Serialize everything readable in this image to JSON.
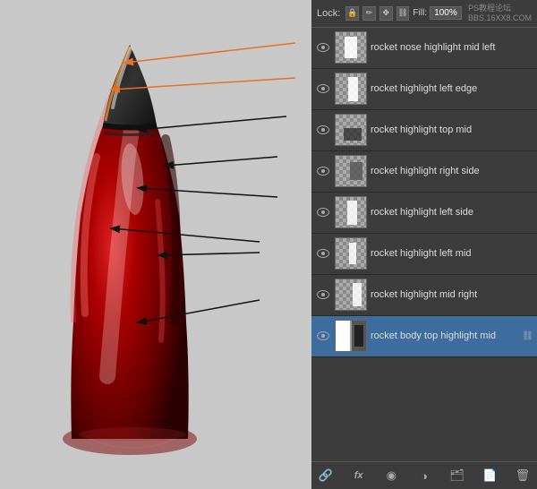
{
  "toolbar": {
    "lock_label": "Lock:",
    "fill_label": "Fill:",
    "fill_value": "100%",
    "watermark": "PS教程论坛\nBBS.16XX8.COM"
  },
  "layers": [
    {
      "id": 1,
      "name": "rocket nose highlight mid left",
      "visible": true,
      "selected": false,
      "thumb_type": "checker_white"
    },
    {
      "id": 2,
      "name": "rocket highlight left edge",
      "visible": true,
      "selected": false,
      "thumb_type": "checker_white"
    },
    {
      "id": 3,
      "name": "rocket highlight top mid",
      "visible": true,
      "selected": false,
      "thumb_type": "checker_dark"
    },
    {
      "id": 4,
      "name": "rocket highlight right side",
      "visible": true,
      "selected": false,
      "thumb_type": "checker_dark"
    },
    {
      "id": 5,
      "name": "rocket highlight left side",
      "visible": true,
      "selected": false,
      "thumb_type": "checker_white"
    },
    {
      "id": 6,
      "name": "rocket highlight left mid",
      "visible": true,
      "selected": false,
      "thumb_type": "checker_white"
    },
    {
      "id": 7,
      "name": "rocket highlight mid right",
      "visible": true,
      "selected": false,
      "thumb_type": "checker_white"
    },
    {
      "id": 8,
      "name": "rocket body top highlight mid",
      "visible": true,
      "selected": true,
      "thumb_type": "white_mask"
    }
  ],
  "bottom_toolbar": {
    "link_icon": "🔗",
    "fx_icon": "fx",
    "circle_icon": "◉",
    "folder_icon": "📁",
    "new_icon": "📄",
    "trash_icon": "🗑"
  },
  "icons": {
    "lock": "🔒",
    "brush": "✏",
    "move": "✥",
    "chain": "🔗"
  }
}
